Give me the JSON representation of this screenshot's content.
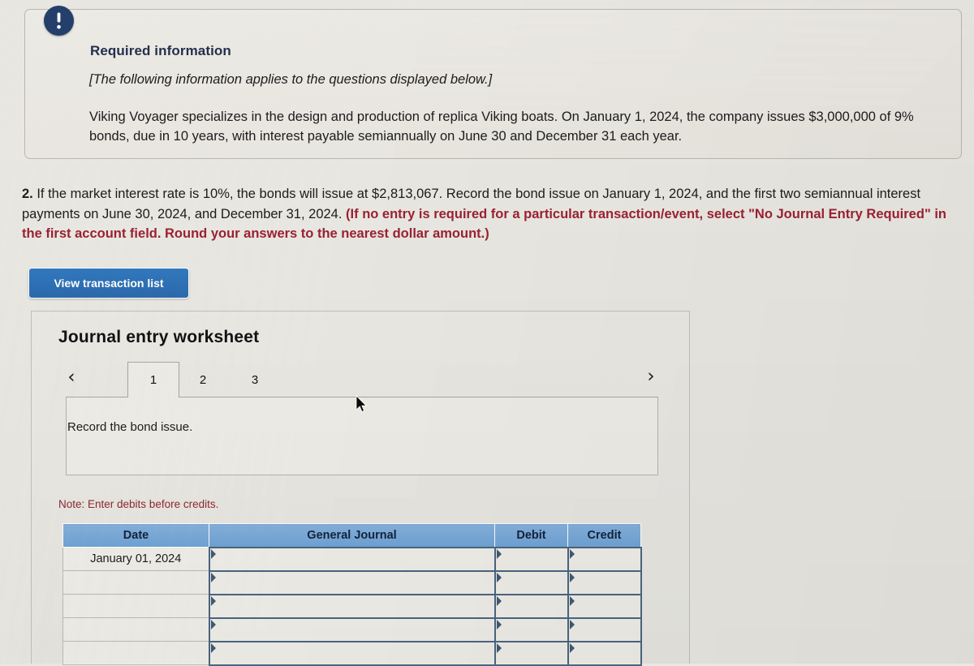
{
  "info_box": {
    "icon": "exclamation-circle-icon",
    "heading": "Required information",
    "italic_note": "[The following information applies to the questions displayed below.]",
    "body": "Viking Voyager specializes in the design and production of replica Viking boats. On January 1, 2024, the company issues $3,000,000 of 9% bonds, due in 10 years, with interest payable semiannually on June 30 and December 31 each year."
  },
  "question": {
    "number": "2.",
    "text_part_1": " If the market interest rate is 10%, the bonds will issue at $2,813,067. Record the bond issue on January 1, 2024, and the first two semiannual interest payments on June 30, 2024, and December 31, 2024. ",
    "text_bold_red": "(If no entry is required for a particular transaction/event, select \"No Journal Entry Required\" in the first account field. Round your answers to the nearest dollar amount.)"
  },
  "buttons": {
    "view_transaction_list": "View transaction list"
  },
  "worksheet": {
    "title": "Journal entry worksheet",
    "prev_icon": "chevron-left-icon",
    "next_icon": "chevron-right-icon",
    "tabs": [
      {
        "label": "1",
        "selected": true
      },
      {
        "label": "2",
        "selected": false
      },
      {
        "label": "3",
        "selected": false
      }
    ],
    "prompt": "Record the bond issue.",
    "note": "Note: Enter debits before credits."
  },
  "journal_table": {
    "columns": [
      "Date",
      "General Journal",
      "Debit",
      "Credit"
    ],
    "rows": [
      {
        "date": "January 01, 2024",
        "general_journal": "",
        "debit": "",
        "credit": ""
      },
      {
        "date": "",
        "general_journal": "",
        "debit": "",
        "credit": ""
      },
      {
        "date": "",
        "general_journal": "",
        "debit": "",
        "credit": ""
      },
      {
        "date": "",
        "general_journal": "",
        "debit": "",
        "credit": ""
      },
      {
        "date": "",
        "general_journal": "",
        "debit": "",
        "credit": ""
      }
    ]
  },
  "colors": {
    "page_background": "#e9e7e1",
    "accent_blue": "#2a69ac",
    "table_header_blue": "#6ea2d4",
    "red_bold": "#9b2132",
    "navy": "#243f6b"
  }
}
